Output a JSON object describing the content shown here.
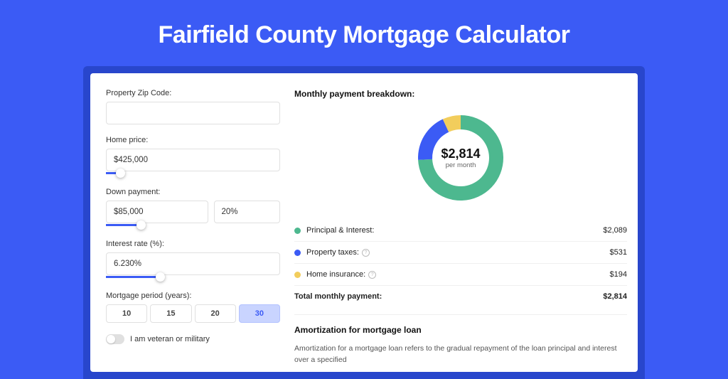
{
  "page": {
    "title": "Fairfield County Mortgage Calculator"
  },
  "form": {
    "zip_label": "Property Zip Code:",
    "zip_value": "",
    "home_price_label": "Home price:",
    "home_price_value": "$425,000",
    "home_price_slider_pct": 8,
    "down_label": "Down payment:",
    "down_value": "$85,000",
    "down_pct_value": "20%",
    "down_slider_pct": 20,
    "rate_label": "Interest rate (%):",
    "rate_value": "6.230%",
    "rate_slider_pct": 31,
    "period_label": "Mortgage period (years):",
    "period_options": [
      "10",
      "15",
      "20",
      "30"
    ],
    "period_selected": "30",
    "veteran_label": "I am veteran or military"
  },
  "breakdown": {
    "title": "Monthly payment breakdown:",
    "total_amount": "$2,814",
    "total_sub": "per month",
    "items": [
      {
        "label": "Principal & Interest:",
        "value": "$2,089",
        "color": "#4db88f",
        "info": false
      },
      {
        "label": "Property taxes:",
        "value": "$531",
        "color": "#3b5bf5",
        "info": true
      },
      {
        "label": "Home insurance:",
        "value": "$194",
        "color": "#f2cd5c",
        "info": true
      }
    ],
    "total_label": "Total monthly payment:",
    "total_value": "$2,814"
  },
  "amort": {
    "title": "Amortization for mortgage loan",
    "text": "Amortization for a mortgage loan refers to the gradual repayment of the loan principal and interest over a specified"
  },
  "chart_data": {
    "type": "pie",
    "title": "Monthly payment breakdown",
    "series": [
      {
        "name": "Principal & Interest",
        "value": 2089,
        "color": "#4db88f"
      },
      {
        "name": "Property taxes",
        "value": 531,
        "color": "#3b5bf5"
      },
      {
        "name": "Home insurance",
        "value": 194,
        "color": "#f2cd5c"
      }
    ],
    "total": 2814,
    "center_label": "$2,814 per month"
  }
}
